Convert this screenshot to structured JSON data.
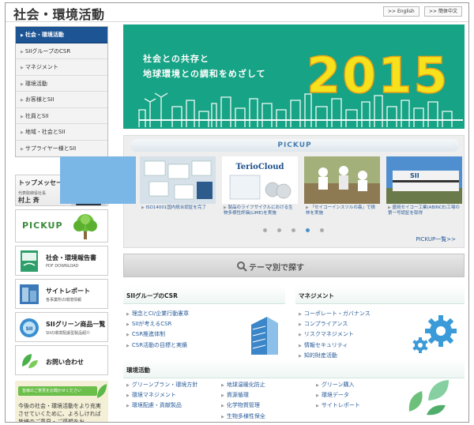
{
  "page": {
    "title": "社会・環境活動"
  },
  "lang_links": {
    "english": ">> English",
    "chinese": ">> 簡体中文"
  },
  "sidebar": {
    "items": [
      {
        "label": "社会・環境活動",
        "active": true
      },
      {
        "label": "SIIグループのCSR"
      },
      {
        "label": "マネジメント"
      },
      {
        "label": "環境活動"
      },
      {
        "label": "お客様とSII"
      },
      {
        "label": "社員とSII"
      },
      {
        "label": "地域・社会とSII"
      },
      {
        "label": "サプライヤー様とSII"
      }
    ],
    "top_message": {
      "title": "トップメッセージ",
      "role": "代表取締役社長",
      "name": "村上 斉"
    },
    "pickup_label": "PICKUP",
    "buttons": [
      {
        "title": "社会・環境報告書",
        "sub": "PDF DOWNLOAD",
        "icon": "report-icon"
      },
      {
        "title": "サイトレポート",
        "sub": "各事業所の環境情報",
        "icon": "building-icon"
      },
      {
        "title": "SIIグリーン商品一覧",
        "sub": "SIIの環境配慮型製品紹介",
        "icon": "green-product-icon"
      },
      {
        "title": "お問い合わせ",
        "sub": "",
        "icon": "leaf-icon"
      }
    ],
    "note": {
      "header": "皆様のご意見をお聞かせください",
      "body": "今後の社会・環境活動をより充実させていくために、よろしければ皆様のご意見・ご感想をお"
    }
  },
  "hero": {
    "line1": "社会との共存と",
    "line2": "地球環境との調和をめざして",
    "year": "2015",
    "color": "#17a385"
  },
  "pickup": {
    "header": "PICKUP",
    "cards": [
      {
        "caption": "ISO14001国内統合認証を完了"
      },
      {
        "caption": "製品のライフサイクルにおける生物多様性評価(LIME)を実施",
        "logo": "TerioCloud"
      },
      {
        "caption": "「セイコーインスツルの森」で積林を実施"
      },
      {
        "caption": "盛岡セイコー工業(ABINCE)工場の第一号認証を取得",
        "logo": "SII"
      }
    ],
    "active_dot": 3,
    "more": "PICKUP一覧>>"
  },
  "theme_search": {
    "label": "テーマ別で探す"
  },
  "sections": {
    "csr": {
      "title": "SIIグループのCSR",
      "links": [
        "理念とCI/企業行動憲章",
        "SIIが考えるCSR",
        "CSR推進体制",
        "CSR活動の目標と実績"
      ]
    },
    "management": {
      "title": "マネジメント",
      "links": [
        "コーポレート・ガバナンス",
        "コンプライアンス",
        "リスクマネジメント",
        "情報セキュリティ",
        "知的財産活動"
      ]
    },
    "environment": {
      "title": "環境活動",
      "col1": [
        "グリーンプラン・環境方針",
        "環境マネジメント",
        "環境配慮・貢献製品"
      ],
      "col2": [
        "地球温暖化防止",
        "資源循環",
        "化学物質管理",
        "生物多様性保全"
      ],
      "col3": [
        "グリーン購入",
        "環境データ",
        "サイトレポート"
      ]
    }
  }
}
